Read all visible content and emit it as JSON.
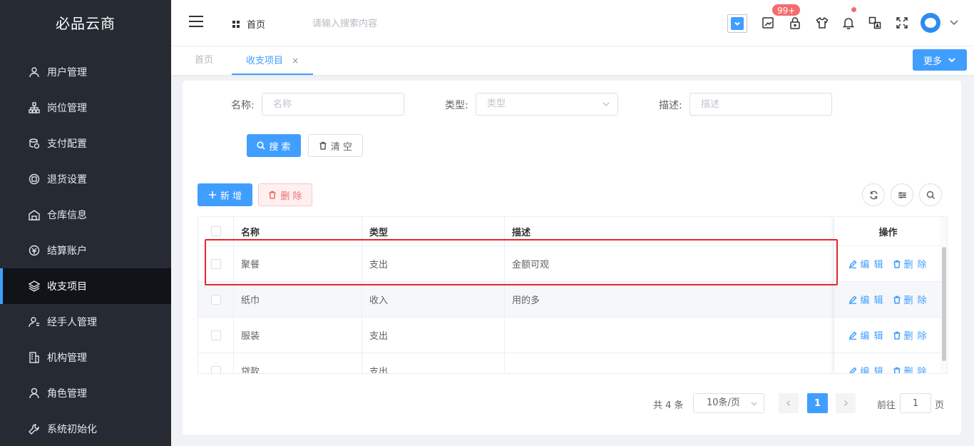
{
  "app": {
    "title": "必品云商"
  },
  "sidebar": {
    "items": [
      {
        "label": "用户管理",
        "icon": "user-icon",
        "active": false
      },
      {
        "label": "岗位管理",
        "icon": "org-tree-icon",
        "active": false
      },
      {
        "label": "支付配置",
        "icon": "coins-icon",
        "active": false
      },
      {
        "label": "退货设置",
        "icon": "return-icon",
        "active": false
      },
      {
        "label": "仓库信息",
        "icon": "warehouse-icon",
        "active": false
      },
      {
        "label": "结算账户",
        "icon": "settle-account-icon",
        "active": false
      },
      {
        "label": "收支项目",
        "icon": "layers-icon",
        "active": true
      },
      {
        "label": "经手人管理",
        "icon": "handler-icon",
        "active": false
      },
      {
        "label": "机构管理",
        "icon": "building-icon",
        "active": false
      },
      {
        "label": "角色管理",
        "icon": "role-icon",
        "active": false
      },
      {
        "label": "系统初始化",
        "icon": "wrench-icon",
        "active": false
      }
    ]
  },
  "header": {
    "breadcrumb": "首页",
    "search_placeholder": "请输入搜索内容",
    "notification_badge": "99+"
  },
  "tabs": {
    "home": "首页",
    "current": "收支项目",
    "close": "×",
    "more": "更多"
  },
  "filters": {
    "name_label": "名称:",
    "name_placeholder": "名称",
    "type_label": "类型:",
    "type_placeholder": "类型",
    "desc_label": "描述:",
    "desc_placeholder": "描述",
    "search_button": "搜 索",
    "clear_button": "清 空"
  },
  "toolbar": {
    "add_button": "新 增",
    "delete_button": "删 除"
  },
  "table": {
    "columns": [
      "名称",
      "类型",
      "描述",
      "操作"
    ],
    "rows": [
      {
        "name": "聚餐",
        "type": "支出",
        "desc": "金额可观"
      },
      {
        "name": "纸巾",
        "type": "收入",
        "desc": "用的多"
      },
      {
        "name": "服装",
        "type": "支出",
        "desc": ""
      },
      {
        "name": "贷款",
        "type": "支出",
        "desc": ""
      }
    ],
    "edit_label": "编 辑",
    "delete_label": "删 除"
  },
  "pagination": {
    "total": "共 4 条",
    "page_size": "10条/页",
    "current_page": "1",
    "goto_label": "前往",
    "goto_value": "1",
    "page_suffix": "页"
  },
  "colors": {
    "primary": "#409eff",
    "sidebar_bg": "#262b33",
    "danger": "#f56c6c",
    "highlight": "#e8242a"
  }
}
